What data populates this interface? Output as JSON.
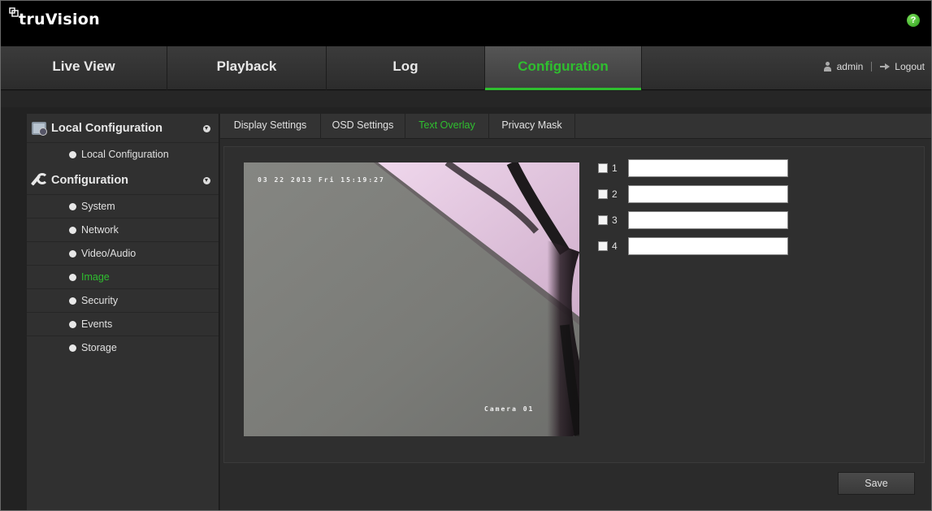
{
  "app": {
    "logo_text": "truVision",
    "help_glyph": "?"
  },
  "nav": {
    "tabs": [
      {
        "label": "Live View"
      },
      {
        "label": "Playback"
      },
      {
        "label": "Log"
      },
      {
        "label": "Configuration"
      }
    ],
    "active_tab": "Configuration",
    "user": "admin",
    "logout": "Logout"
  },
  "sidebar": {
    "sections": [
      {
        "title": "Local Configuration",
        "items": [
          "Local Configuration"
        ]
      },
      {
        "title": "Configuration",
        "items": [
          "System",
          "Network",
          "Video/Audio",
          "Image",
          "Security",
          "Events",
          "Storage"
        ]
      }
    ],
    "active_item": "Image"
  },
  "subtabs": [
    "Display Settings",
    "OSD Settings",
    "Text Overlay",
    "Privacy Mask"
  ],
  "active_subtab": "Text Overlay",
  "video": {
    "osd_time": "03 22 2013 Fri 15:19:27",
    "osd_camera": "Camera 01"
  },
  "overlays": [
    {
      "num": "1",
      "checked": false,
      "text": ""
    },
    {
      "num": "2",
      "checked": false,
      "text": ""
    },
    {
      "num": "3",
      "checked": false,
      "text": ""
    },
    {
      "num": "4",
      "checked": false,
      "text": ""
    }
  ],
  "save_label": "Save",
  "colors": {
    "accent": "#2fbf2f",
    "background": "#222222",
    "panel": "#2b2b2b"
  }
}
